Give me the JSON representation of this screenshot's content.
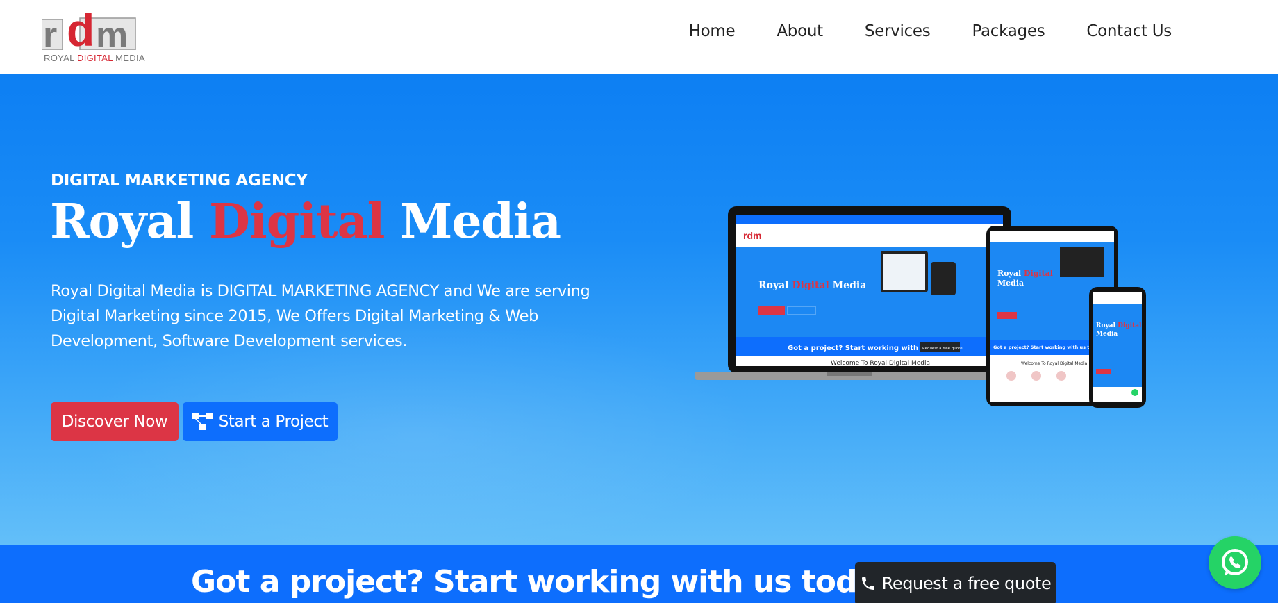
{
  "logo": {
    "mark": "rdm",
    "text_part1": "ROYAL ",
    "text_part2": "DIGITAL",
    "text_part3": " MEDIA"
  },
  "nav": {
    "items": [
      {
        "label": "Home"
      },
      {
        "label": "About"
      },
      {
        "label": "Services"
      },
      {
        "label": "Packages"
      },
      {
        "label": "Contact Us"
      }
    ]
  },
  "hero": {
    "kicker": "DIGITAL MARKETING AGENCY",
    "title_part1": "Royal ",
    "title_highlight": "Digital",
    "title_part2": " Media",
    "description": "Royal Digital Media is DIGITAL MARKETING AGENCY and We are serving Digital Marketing since 2015, We Offers Digital Marketing & Web Development, Software Development services.",
    "discover_label": "Discover Now",
    "start_label": "Start a Project"
  },
  "mockup": {
    "laptop_title_part1": "Royal ",
    "laptop_title_highlight": "Digital",
    "laptop_title_part2": " Media",
    "laptop_cta": "Got a project? Start working with us today!",
    "laptop_cta_btn": "Request a free quote",
    "laptop_welcome": "Welcome To Royal Digital Media",
    "tablet_cta": "Got a project? Start working with us today",
    "tablet_welcome": "Welcome To Royal Digital Media"
  },
  "cta": {
    "text": "Got a project? Start working with us today!",
    "button_label": "Request a free quote"
  },
  "colors": {
    "accent_red": "#dc3545",
    "primary_blue": "#0d6efd",
    "dark": "#212529",
    "whatsapp": "#25d366"
  },
  "icons": [
    "project-diagram-icon",
    "phone-icon",
    "whatsapp-icon"
  ]
}
